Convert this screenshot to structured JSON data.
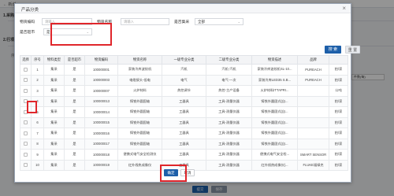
{
  "background": {
    "back_label": "← 新增",
    "section1": "1.采购计",
    "section2": "2.行项目",
    "column_label": "序号",
    "row_select_value": "件数(每)",
    "submit_label": "提交",
    "save_label": "保存"
  },
  "dialog": {
    "title": "产品分类",
    "close_icon": "×",
    "filters": {
      "code_label": "物资编码",
      "code_placeholder": "请输入",
      "name_label": "物资名称",
      "name_placeholder": "请输入",
      "strategic_label": "是否集采",
      "strategic_value": "全部",
      "supermarket_label": "是否超市",
      "supermarket_value": "是"
    },
    "search_label": "搜 索",
    "reset_label": "重 置",
    "table": {
      "headers": [
        "选择",
        "序号",
        "物料类型",
        "是否超市",
        "物资编码",
        "物资名称",
        "一级专业分类",
        "二级专业分类",
        "物资描述",
        "品牌",
        ""
      ],
      "rows": [
        [
          "1",
          "集采",
          "是",
          "100000001",
          "家装冷库波纹机",
          "汽机",
          "汽机-汽机",
          "家装冷库波纹机SL-10...",
          "PUREACH",
          "拍/家"
        ],
        [
          "2",
          "集采",
          "是",
          "100000003",
          "电缆接头-低电",
          "电气",
          "电气-一次",
          "家装冷库LED35 S.B...",
          "PUREACH",
          "拍/家"
        ],
        [
          "3",
          "集采",
          "是",
          "100000007",
          "火炉材料",
          "热控调节",
          "热控-主产设备",
          "火炉材料ITTAPRI...",
          "",
          "公吨"
        ],
        [
          "4",
          "集采",
          "是",
          "100000013",
          "铸铁外圆固轴",
          "工器具",
          "工具-测量仪器",
          "铸铁外圆固式(自...",
          "",
          "拍/家"
        ],
        [
          "5",
          "集采",
          "是",
          "100000014",
          "铸铁外圆固轴",
          "工器具",
          "工具-测量仪器",
          "铸铁外圆固式(自...",
          "",
          "拍/家"
        ],
        [
          "6",
          "集采",
          "是",
          "100000015",
          "铸铁外圆固轴",
          "工器具",
          "工具-测量仪器",
          "铸铁外圆固式(自...",
          "",
          "拍/家"
        ],
        [
          "7",
          "集采",
          "是",
          "100000016",
          "铸铁外圆固轴",
          "工器具",
          "工具-测量仪器",
          "铸铁外圆固式(自...",
          "",
          "拍/家"
        ],
        [
          "8",
          "集采",
          "是",
          "100000017",
          "铸铁外圆固轴",
          "工器具",
          "工具-测量仪器",
          "铸铁外圆固式(自...",
          "",
          "拍/家"
        ],
        [
          "9",
          "集采",
          "是",
          "100000018",
          "便携式电气安全检测仪",
          "工器具",
          "工具-测量仪器",
          "便携式电气安全检...",
          "SMART SENSOR",
          "拍/家"
        ],
        [
          "10",
          "集采",
          "是",
          "100000019",
          "红外线热成像仪",
          "工器具",
          "工具-测量仪器",
          "红外线热成像仪(...",
          "FLUKE福禄克",
          "拍/家"
        ]
      ]
    },
    "ok_label": "确定",
    "cancel_label": "取消"
  }
}
